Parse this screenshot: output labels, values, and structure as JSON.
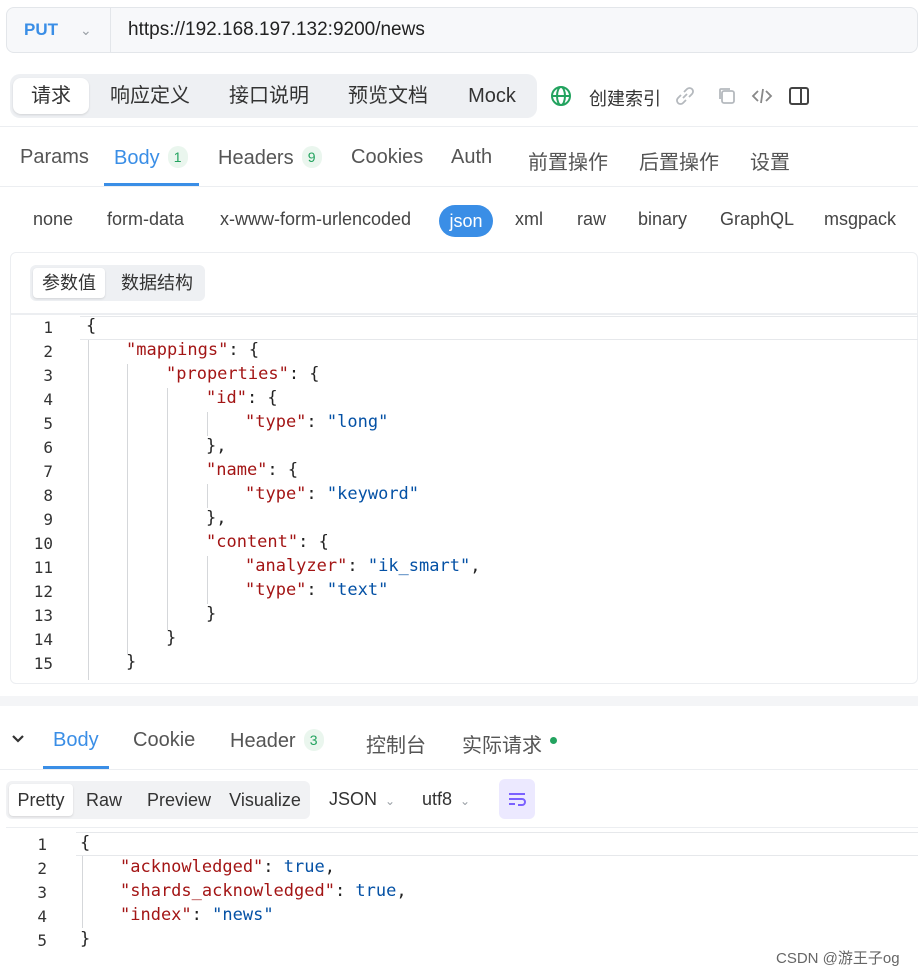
{
  "request": {
    "method": "PUT",
    "url": "https://192.168.197.132:9200/news"
  },
  "subtabs": [
    "请求",
    "响应定义",
    "接口说明",
    "预览文档",
    "Mock"
  ],
  "index_name": "创建索引",
  "main_tabs": [
    {
      "label": "Params"
    },
    {
      "label": "Body",
      "count": "1"
    },
    {
      "label": "Headers",
      "count": "9"
    },
    {
      "label": "Cookies"
    },
    {
      "label": "Auth"
    },
    {
      "label": "前置操作"
    },
    {
      "label": "后置操作"
    },
    {
      "label": "设置"
    }
  ],
  "body_types": [
    "none",
    "form-data",
    "x-www-form-urlencoded",
    "json",
    "xml",
    "raw",
    "binary",
    "GraphQL",
    "msgpack"
  ],
  "editor_modes": [
    "参数值",
    "数据结构"
  ],
  "request_body_lines": [
    "1",
    "2",
    "3",
    "4",
    "5",
    "6",
    "7",
    "8",
    "9",
    "10",
    "11",
    "12",
    "13",
    "14",
    "15"
  ],
  "request_code": {
    "l1": "{",
    "l2k": "\"mappings\"",
    "l2p": ": {",
    "l3k": "\"properties\"",
    "l3p": ": {",
    "l4k": "\"id\"",
    "l4p": ": {",
    "l5k": "\"type\"",
    "l5p": ": ",
    "l5v": "\"long\"",
    "l6": "},",
    "l7k": "\"name\"",
    "l7p": ": {",
    "l8k": "\"type\"",
    "l8p": ": ",
    "l8v": "\"keyword\"",
    "l9": "},",
    "l10k": "\"content\"",
    "l10p": ": {",
    "l11k": "\"analyzer\"",
    "l11p": ": ",
    "l11v": "\"ik_smart\"",
    "l11c": ",",
    "l12k": "\"type\"",
    "l12p": ": ",
    "l12v": "\"text\"",
    "l13": "}",
    "l14": "}",
    "l15": "}"
  },
  "response_tabs": [
    {
      "label": "Body"
    },
    {
      "label": "Cookie"
    },
    {
      "label": "Header",
      "count": "3"
    },
    {
      "label": "控制台"
    },
    {
      "label": "实际请求"
    }
  ],
  "view_tabs": [
    "Pretty",
    "Raw",
    "Preview",
    "Visualize"
  ],
  "format_select": "JSON",
  "encoding_select": "utf8",
  "response_lines": [
    "1",
    "2",
    "3",
    "4",
    "5"
  ],
  "response_code": {
    "l1": "{",
    "l2k": "\"acknowledged\"",
    "l2p": ": ",
    "l2v": "true",
    "l2c": ",",
    "l3k": "\"shards_acknowledged\"",
    "l3p": ": ",
    "l3v": "true",
    "l3c": ",",
    "l4k": "\"index\"",
    "l4p": ": ",
    "l4v": "\"news\"",
    "l5": "}"
  },
  "watermark": "CSDN @游王子og",
  "colors": {
    "accent": "#3a8ee6",
    "json_key": "#a31515",
    "json_value": "#0451a5",
    "badge_green": "#23a35f"
  }
}
